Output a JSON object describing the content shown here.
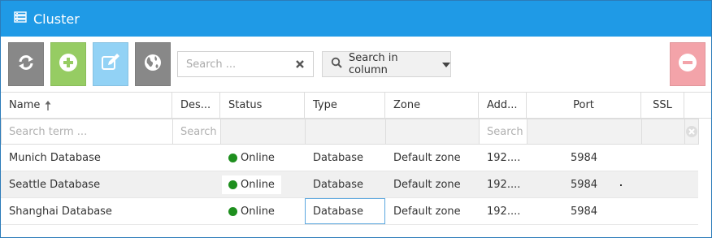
{
  "window": {
    "title": "Cluster",
    "title_icon": "server-icon"
  },
  "colors": {
    "titlebar": "#1f9ae6",
    "refresh_button": "#888888",
    "add_button": "#96cc63",
    "edit_button": "#92d2f5",
    "globe_button": "#888888",
    "remove_button": "#f3a3a9",
    "status_online": "#1e8f1e"
  },
  "toolbar": {
    "buttons": [
      {
        "name": "refresh",
        "icon": "refresh-icon"
      },
      {
        "name": "add",
        "icon": "plus-circle-icon"
      },
      {
        "name": "edit",
        "icon": "edit-icon"
      },
      {
        "name": "globe",
        "icon": "globe-icon"
      },
      {
        "name": "remove",
        "icon": "minus-circle-icon"
      }
    ],
    "search": {
      "placeholder": "Search ...",
      "value": ""
    },
    "search_in_column_label": "Search in column"
  },
  "table": {
    "columns": [
      "Name",
      "Des...",
      "Status",
      "Type",
      "Zone",
      "Add...",
      "Port",
      "SSL"
    ],
    "sort": {
      "column": "Name",
      "direction": "asc"
    },
    "filters": {
      "name_placeholder": "Search term ...",
      "desc_placeholder": "Search",
      "address_placeholder": "Search"
    },
    "rows": [
      {
        "name": "Munich Database",
        "description": "",
        "status": "Online",
        "type": "Database",
        "zone": "Default zone",
        "address": "192....",
        "port": "5984",
        "ssl": ""
      },
      {
        "name": "Seattle Database",
        "description": "",
        "status": "Online",
        "type": "Database",
        "zone": "Default zone",
        "address": "192....",
        "port": "5984",
        "ssl": ""
      },
      {
        "name": "Shanghai Database",
        "description": "",
        "status": "Online",
        "type": "Database",
        "zone": "Default zone",
        "address": "192....",
        "port": "5984",
        "ssl": ""
      }
    ]
  }
}
